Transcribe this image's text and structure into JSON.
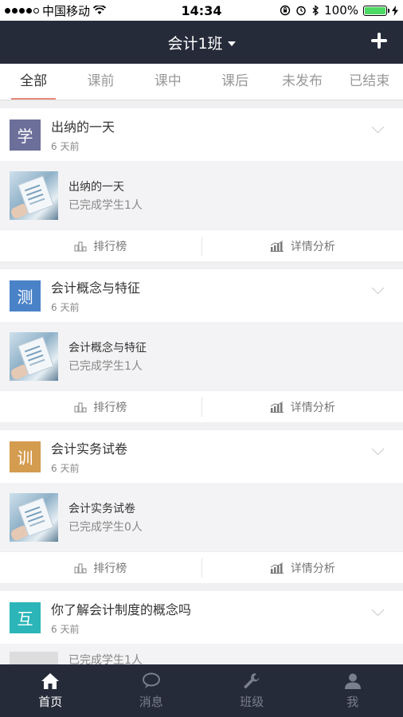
{
  "status_bar": {
    "carrier": "中国移动",
    "time": "14:34",
    "battery": "100%"
  },
  "nav": {
    "title": "会计1班"
  },
  "tabs": [
    {
      "label": "全部"
    },
    {
      "label": "课前"
    },
    {
      "label": "课中"
    },
    {
      "label": "课后"
    },
    {
      "label": "未发布"
    },
    {
      "label": "已结束"
    }
  ],
  "cards": [
    {
      "badge": "学",
      "badge_color": "#6b6f9a",
      "title": "出纳的一天",
      "time": "6 天前",
      "item_title": "出纳的一天",
      "item_status": "已完成学生1人",
      "rank_label": "排行榜",
      "detail_label": "详情分析"
    },
    {
      "badge": "测",
      "badge_color": "#4a82c8",
      "title": "会计概念与特征",
      "time": "6 天前",
      "item_title": "会计概念与特征",
      "item_status": "已完成学生1人",
      "rank_label": "排行榜",
      "detail_label": "详情分析"
    },
    {
      "badge": "训",
      "badge_color": "#d49c4f",
      "title": "会计实务试卷",
      "time": "6 天前",
      "item_title": "会计实务试卷",
      "item_status": "已完成学生0人",
      "rank_label": "排行榜",
      "detail_label": "详情分析"
    },
    {
      "badge": "互",
      "badge_color": "#2bb5b8",
      "title": "你了解会计制度的概念吗",
      "time": "6 天前",
      "item_status": "已完成学生1人"
    }
  ],
  "tab_bar": [
    {
      "label": "首页",
      "icon": "home-icon"
    },
    {
      "label": "消息",
      "icon": "chat-icon"
    },
    {
      "label": "班级",
      "icon": "wrench-icon"
    },
    {
      "label": "我",
      "icon": "person-icon"
    }
  ]
}
